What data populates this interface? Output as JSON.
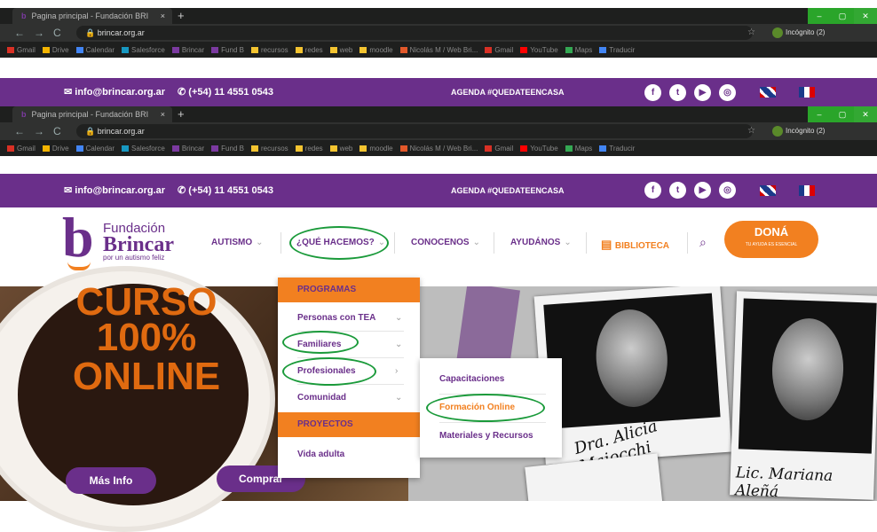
{
  "browser": {
    "tab_title": "Pagina principal - Fundación BRI",
    "tab_close": "×",
    "new_tab": "+",
    "url": "brincar.org.ar",
    "incognito": "Incógnito (2)",
    "window_min": "–",
    "window_max": "▢",
    "window_close": "✕",
    "bookmarks": [
      {
        "label": "Gmail",
        "color": "#d93025"
      },
      {
        "label": "Drive",
        "color": "#f4b400"
      },
      {
        "label": "Calendar",
        "color": "#4285f4"
      },
      {
        "label": "Salesforce",
        "color": "#1798c1"
      },
      {
        "label": "Brincar",
        "color": "#7b3aa0"
      },
      {
        "label": "Fund B",
        "color": "#7b3aa0"
      },
      {
        "label": "recursos",
        "color": "#f4c430"
      },
      {
        "label": "redes",
        "color": "#f4c430"
      },
      {
        "label": "web",
        "color": "#f4c430"
      },
      {
        "label": "moodle",
        "color": "#f4c430"
      },
      {
        "label": "Nicolás M / Web Bri...",
        "color": "#e2582a"
      },
      {
        "label": "Gmail",
        "color": "#d93025"
      },
      {
        "label": "YouTube",
        "color": "#ff0000"
      },
      {
        "label": "Maps",
        "color": "#34a853"
      },
      {
        "label": "Traducir",
        "color": "#4285f4"
      }
    ]
  },
  "topbar": {
    "email": "info@brincar.org.ar",
    "phone": "(+54) 11 4551 0543",
    "agenda": "AGENDA #QUEDATEENCASA",
    "social": [
      "f",
      "t",
      "▶",
      "◎"
    ]
  },
  "logo": {
    "b": "b",
    "fundacion": "Fundación",
    "brincar": "Brincar",
    "tagline": "por un autismo feliz"
  },
  "nav": {
    "autismo": "AUTISMO",
    "que_hacemos": "¿QUÉ HACEMOS?",
    "conocenos": "CONOCENOS",
    "ayudanos": "AYUDÁNOS",
    "biblioteca": "BIBLIOTECA",
    "chevron": "⌄"
  },
  "dona": {
    "label": "DONÁ",
    "sub": "TU AYUDA ES ESENCIAL"
  },
  "hero": {
    "line1": "CURSO",
    "line2": "100%",
    "line3": "ONLINE",
    "mas_info": "Más Info",
    "comprar": "Comprar",
    "photo1_caption": "Dra. Alicia Maiocchi",
    "photo2_caption": "Lic. Mariana Aleñá"
  },
  "dropdown": {
    "programas": "PROGRAMAS",
    "items": [
      {
        "label": "Personas con TEA",
        "chev": "⌄"
      },
      {
        "label": "Familiares",
        "chev": "⌄"
      },
      {
        "label": "Profesionales",
        "chev": "›"
      },
      {
        "label": "Comunidad",
        "chev": "⌄"
      }
    ],
    "proyectos": "PROYECTOS",
    "vida_adulta": "Vida adulta"
  },
  "submenu": {
    "items": [
      "Capacitaciones",
      "Formación Online",
      "Materiales y Recursos"
    ]
  },
  "colors": {
    "purple": "#6a2f8a",
    "orange": "#f28020",
    "highlight": "#1a9a3a"
  }
}
